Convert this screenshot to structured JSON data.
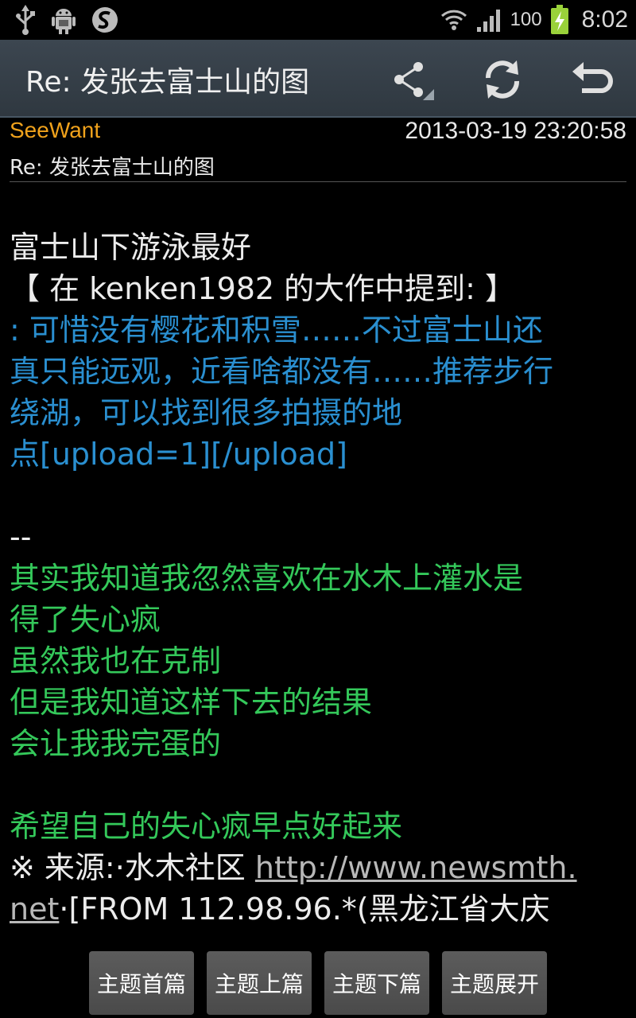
{
  "status_bar": {
    "battery_percent": "100",
    "time": "8:02",
    "icons_left": [
      "usb-icon",
      "android-debug-icon",
      "sync-app-icon"
    ],
    "icons_right": [
      "wifi-icon",
      "signal-icon",
      "battery-charging-icon"
    ]
  },
  "action_bar": {
    "title": "Re: 发张去富士山的图",
    "actions": [
      "share-icon",
      "refresh-icon",
      "back-icon"
    ]
  },
  "post": {
    "author": "SeeWant",
    "datetime": "2013-03-19 23:20:58",
    "subject": "Re: 发张去富士山的图",
    "body": {
      "reply": "富士山下游泳最好",
      "quote_header": "【 在 kenken1982 的大作中提到: 】",
      "quote_lines": [
        ": 可惜没有樱花和积雪……不过富士山还",
        "真只能远观，近看啥都没有……推荐步行",
        "绕湖，可以找到很多拍摄的地",
        "点[upload=1][/upload]"
      ],
      "sig_separator": "--",
      "signature_lines": [
        "其实我知道我忽然喜欢在水木上灌水是",
        "得了失心疯",
        "虽然我也在克制",
        "但是我知道这样下去的结果",
        "会让我我完蛋的"
      ],
      "signature_last": "希望自己的失心疯早点好起来",
      "source_prefix": "※ 来源:·水木社区 ",
      "source_link_part1": "http://www.newsmth.",
      "source_link_part2": "net",
      "source_from": "·[FROM 112.98.96.*(黑龙江省大庆"
    }
  },
  "nav_buttons": {
    "first": "主题首篇",
    "prev": "主题上篇",
    "next": "主题下篇",
    "expand": "主题展开"
  },
  "colors": {
    "author": "#f0a21c",
    "quote": "#2a8fd0",
    "signature": "#34c85a",
    "action_bar": "#3c4650"
  }
}
